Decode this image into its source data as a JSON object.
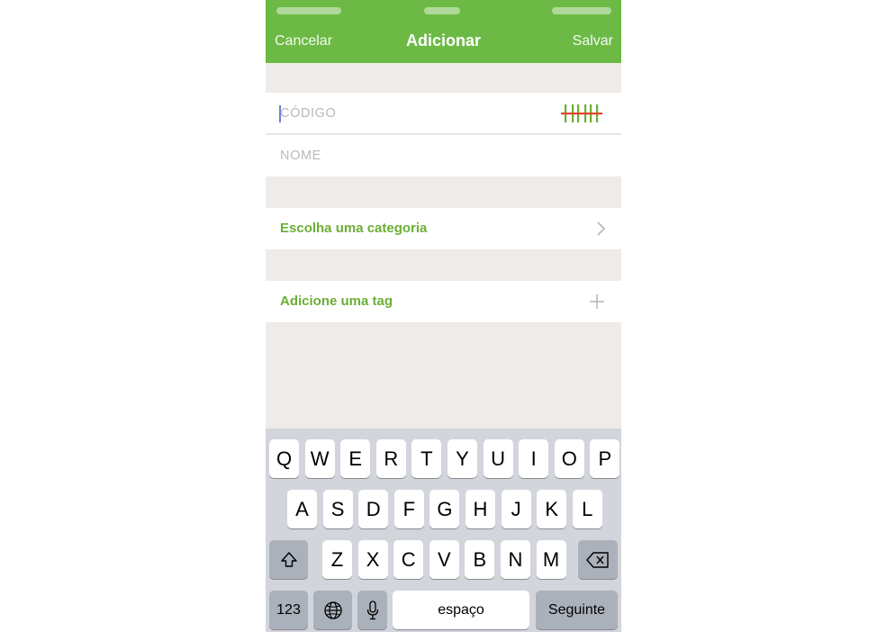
{
  "nav": {
    "cancel_label": "Cancelar",
    "title": "Adicionar",
    "save_label": "Salvar"
  },
  "form": {
    "code_placeholder": "CÓDIGO",
    "name_placeholder": "NOME",
    "category_label": "Escolha uma categoria",
    "tag_label": "Adicione uma tag"
  },
  "icons": {
    "barcode": "barcode-scan-icon",
    "chevron": "chevron-right-icon",
    "plus": "plus-icon",
    "shift": "shift-icon",
    "backspace": "backspace-icon",
    "globe": "globe-icon",
    "mic": "microphone-icon"
  },
  "colors": {
    "accent": "#6cba45",
    "label_green": "#6cae36",
    "background": "#efebe9",
    "keyboard": "#d2d5db",
    "scan_line": "#e0442c"
  },
  "keyboard": {
    "row1": [
      "Q",
      "W",
      "E",
      "R",
      "T",
      "Y",
      "U",
      "I",
      "O",
      "P"
    ],
    "row2": [
      "A",
      "S",
      "D",
      "F",
      "G",
      "H",
      "J",
      "K",
      "L"
    ],
    "row3": [
      "Z",
      "X",
      "C",
      "V",
      "B",
      "N",
      "M"
    ],
    "numbers_label": "123",
    "space_label": "espaço",
    "return_label": "Seguinte"
  }
}
